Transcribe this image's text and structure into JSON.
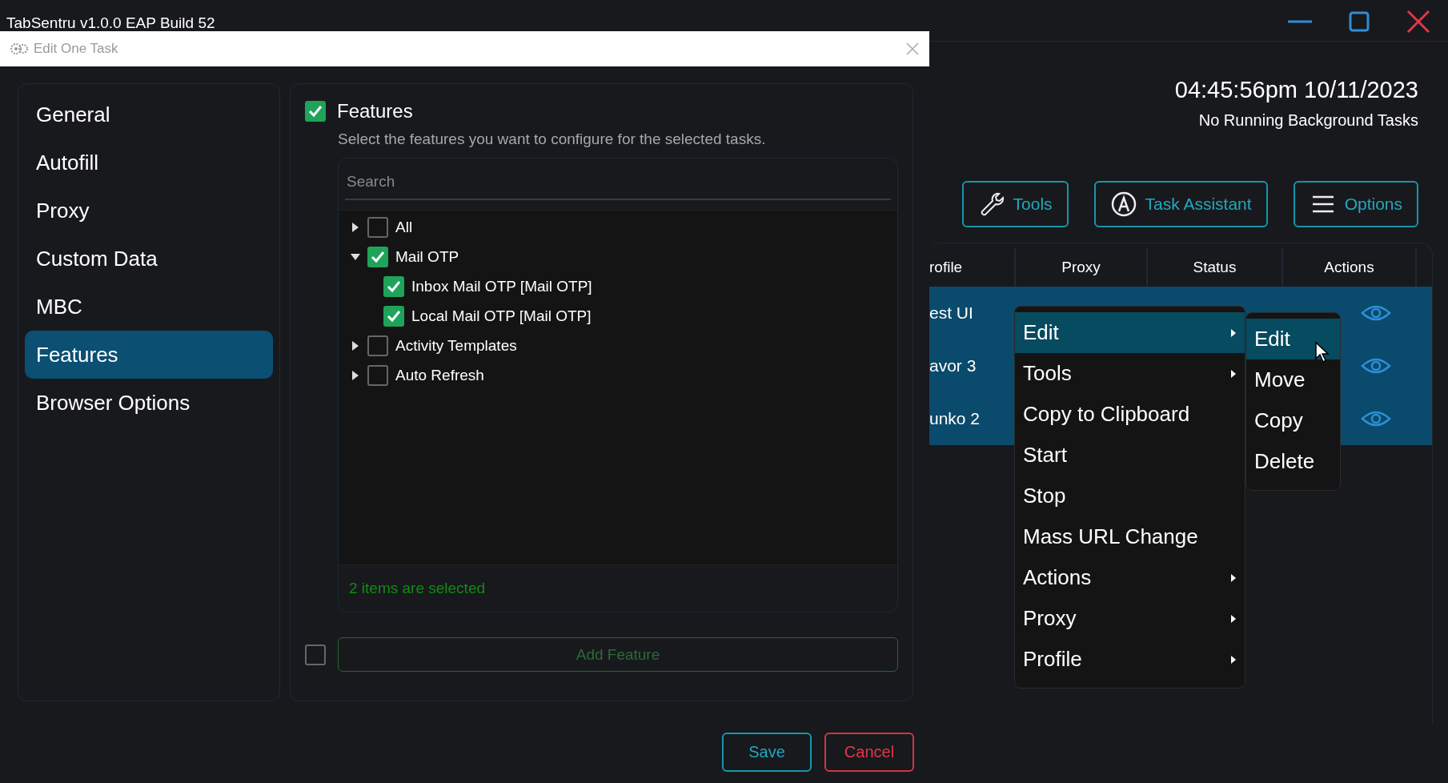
{
  "app": {
    "title": "TabSentru v1.0.0 EAP Build 52"
  },
  "clock": {
    "time": "04:45:56pm 10/11/2023",
    "status": "No Running Background Tasks"
  },
  "toolbar": [
    {
      "label": "Tools",
      "kind": "wrench"
    },
    {
      "label": "Task Assistant",
      "kind": "assistant"
    },
    {
      "label": "Options",
      "kind": "menu"
    }
  ],
  "table": {
    "columns": [
      "rofile",
      "Proxy",
      "Status",
      "Actions"
    ],
    "rows": [
      {
        "profile": "est UI",
        "selected": true
      },
      {
        "profile": "avor 3",
        "selected": true
      },
      {
        "profile": "unko 2",
        "selected": true
      }
    ]
  },
  "dialog": {
    "title": "Edit One Task",
    "nav": [
      {
        "label": "General",
        "selected": false
      },
      {
        "label": "Autofill",
        "selected": false
      },
      {
        "label": "Proxy",
        "selected": false
      },
      {
        "label": "Custom Data",
        "selected": false
      },
      {
        "label": "MBC",
        "selected": false
      },
      {
        "label": "Features",
        "selected": true
      },
      {
        "label": "Browser Options",
        "selected": false
      }
    ],
    "section": {
      "title": "Features",
      "checked": true,
      "description": "Select the features you want to configure for the selected tasks.",
      "search_placeholder": "Search",
      "tree": [
        {
          "label": "All",
          "checked": false,
          "expanded": false
        },
        {
          "label": "Mail OTP",
          "checked": true,
          "expanded": true,
          "children": [
            {
              "label": "Inbox Mail OTP [Mail OTP]",
              "checked": true
            },
            {
              "label": "Local Mail OTP [Mail OTP]",
              "checked": true
            }
          ]
        },
        {
          "label": "Activity Templates",
          "checked": false,
          "expanded": false
        },
        {
          "label": "Auto Refresh",
          "checked": false,
          "expanded": false
        }
      ],
      "selection_summary": "2 items are selected",
      "add_feature": {
        "checked": false,
        "label": "Add Feature",
        "disabled": true
      }
    },
    "buttons": [
      {
        "label": "Save",
        "kind": "primary"
      },
      {
        "label": "Cancel",
        "kind": "danger"
      }
    ]
  },
  "context_menu": {
    "items": [
      {
        "label": "Edit",
        "submenu": true,
        "selected": true
      },
      {
        "label": "Tools",
        "submenu": true,
        "selected": false
      },
      {
        "label": "Copy to Clipboard",
        "submenu": false,
        "selected": false
      },
      {
        "label": "Start",
        "submenu": false,
        "selected": false
      },
      {
        "label": "Stop",
        "submenu": false,
        "selected": false
      },
      {
        "label": "Mass URL Change",
        "submenu": false,
        "selected": false
      },
      {
        "label": "Actions",
        "submenu": true,
        "selected": false
      },
      {
        "label": "Proxy",
        "submenu": true,
        "selected": false
      },
      {
        "label": "Profile",
        "submenu": true,
        "selected": false
      }
    ],
    "submenu": {
      "items": [
        {
          "label": "Edit",
          "selected": true
        },
        {
          "label": "Move",
          "selected": false
        },
        {
          "label": "Copy",
          "selected": false
        },
        {
          "label": "Delete",
          "selected": false
        }
      ]
    }
  }
}
